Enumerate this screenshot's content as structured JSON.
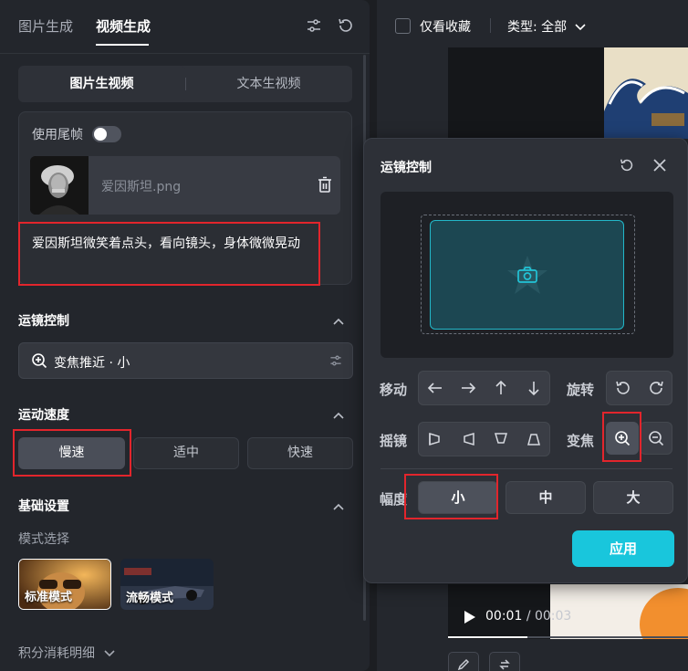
{
  "header": {
    "tabs": [
      {
        "label": "图片生成",
        "active": false
      },
      {
        "label": "视频生成",
        "active": true
      }
    ],
    "icons": [
      "sliders-icon",
      "refresh-icon"
    ]
  },
  "mode_toggle": {
    "options": [
      "图片生视频",
      "文本生视频"
    ],
    "selected": "图片生视频"
  },
  "input_card": {
    "end_frame_label": "使用尾帧",
    "end_frame_enabled": false,
    "file_name": "爱因斯坦.png",
    "prompt": "爱因斯坦微笑着点头，看向镜头，身体微微晃动"
  },
  "camera_section": {
    "title": "运镜控制",
    "selected_value": "变焦推近 · 小"
  },
  "speed_section": {
    "title": "运动速度",
    "options": [
      "慢速",
      "适中",
      "快速"
    ],
    "selected": "慢速"
  },
  "basic_section": {
    "title": "基础设置",
    "mode_label": "模式选择",
    "models": [
      {
        "label": "标准模式",
        "selected": true
      },
      {
        "label": "流畅模式",
        "selected": false
      }
    ],
    "footer_link": "积分消耗明细"
  },
  "right_panel": {
    "favorites_only": "仅看收藏",
    "type_filter": "类型: 全部",
    "time_current": "00:01",
    "time_total": "/ 00:03"
  },
  "popup": {
    "title": "运镜控制",
    "rows": {
      "move": "移动",
      "rotate": "旋转",
      "pan": "摇镜",
      "zoom": "变焦",
      "amplitude": "幅度"
    },
    "amplitude_options": [
      "小",
      "中",
      "大"
    ],
    "amplitude_selected": "小",
    "apply_label": "应用"
  },
  "colors": {
    "accent": "#19c6dc",
    "highlight": "#e2252c"
  }
}
